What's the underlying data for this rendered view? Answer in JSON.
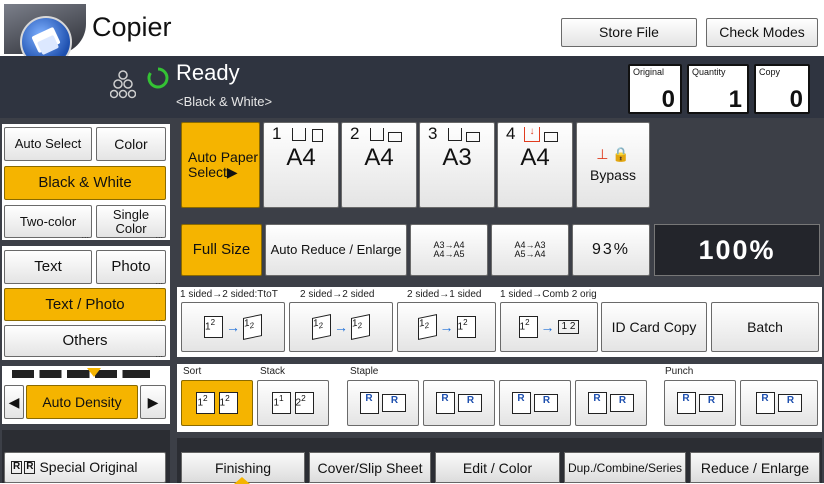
{
  "header": {
    "title": "Copier",
    "store_file": "Store File",
    "check_modes": "Check Modes"
  },
  "status": {
    "text": "Ready",
    "mode": "<Black & White>",
    "original_label": "Original",
    "original_value": "0",
    "quantity_label": "Quantity",
    "quantity_value": "1",
    "copy_label": "Copy",
    "copy_value": "0"
  },
  "color_mode": {
    "auto_select": "Auto Select",
    "color": "Color",
    "black_white": "Black & White",
    "two_color": "Two-color",
    "single_color": "Single Color",
    "selected": "Black & White"
  },
  "original_type": {
    "text": "Text",
    "photo": "Photo",
    "text_photo": "Text / Photo",
    "others": "Others",
    "selected": "Text / Photo"
  },
  "density": {
    "label": "Auto Density",
    "left_arrow": "◀",
    "right_arrow": "▶"
  },
  "special_original": {
    "label": "Special Original"
  },
  "paper": {
    "auto_paper": "Auto Paper",
    "select": "Select▶",
    "trays": [
      {
        "num": "1",
        "size": "A4"
      },
      {
        "num": "2",
        "size": "A4"
      },
      {
        "num": "3",
        "size": "A3"
      },
      {
        "num": "4",
        "size": "A4"
      }
    ],
    "bypass": "Bypass"
  },
  "reduce": {
    "full_size": "Full Size",
    "auto_reduce": "Auto Reduce / Enlarge",
    "a3a4_line1": "A3→A4",
    "a3a4_line2": "A4→A5",
    "a4a3_line1": "A4→A3",
    "a4a3_line2": "A5→A4",
    "percent_93": "93%",
    "ratio": "100%"
  },
  "duplex": {
    "caption1": "1 sided→2 sided:TtoT",
    "caption2": "2 sided→2 sided",
    "caption3": "2 sided→1 sided",
    "caption4": "1 sided→Comb 2 orig",
    "id_card": "ID Card Copy",
    "batch": "Batch"
  },
  "finishing_row": {
    "sort": "Sort",
    "stack": "Stack",
    "staple": "Staple",
    "punch": "Punch"
  },
  "tabs": {
    "finishing": "Finishing",
    "cover": "Cover/Slip Sheet",
    "edit_color": "Edit / Color",
    "dup_combine": "Dup./Combine/Series",
    "reduce_enlarge": "Reduce / Enlarge"
  },
  "colors": {
    "accent": "#f5b400",
    "dark_panel": "#3c3f47",
    "status_bg": "#2f3440",
    "ready_green": "#34c234"
  }
}
